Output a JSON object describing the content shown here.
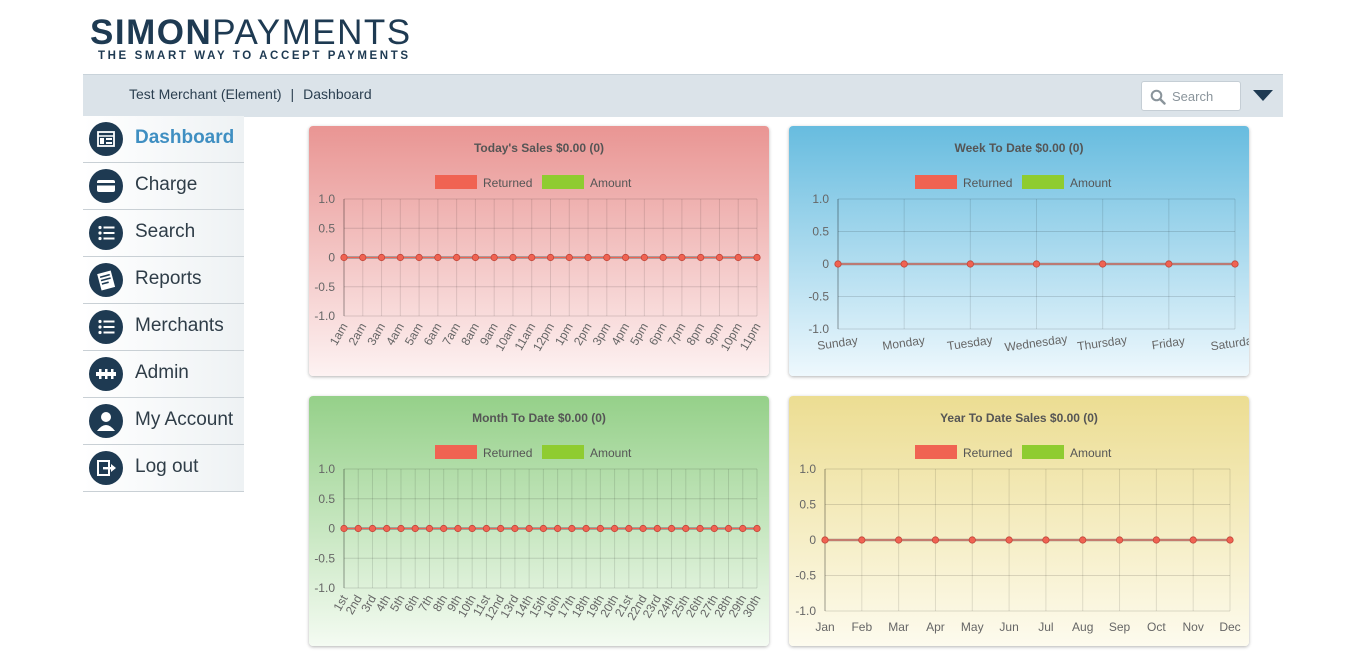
{
  "logo": {
    "bold": "SIMON",
    "light": "PAYMENTS",
    "tagline": "THE SMART WAY TO ACCEPT PAYMENTS"
  },
  "breadcrumb": {
    "merchant": "Test Merchant (Element)",
    "separator": "|",
    "page": "Dashboard"
  },
  "search": {
    "placeholder": "Search",
    "value": ""
  },
  "sidebar": {
    "items": [
      {
        "label": "Dashboard",
        "icon": "dashboard-icon",
        "active": true
      },
      {
        "label": "Charge",
        "icon": "credit-card-icon",
        "active": false
      },
      {
        "label": "Search",
        "icon": "list-icon",
        "active": false
      },
      {
        "label": "Reports",
        "icon": "report-icon",
        "active": false
      },
      {
        "label": "Merchants",
        "icon": "list-icon",
        "active": false
      },
      {
        "label": "Admin",
        "icon": "admin-icon",
        "active": false
      },
      {
        "label": "My Account",
        "icon": "user-icon",
        "active": false
      },
      {
        "label": "Log out",
        "icon": "logout-icon",
        "active": false
      }
    ]
  },
  "colors": {
    "brand": "#1e3a52",
    "active_link": "#3f8fc2",
    "returned": "#f06352",
    "amount": "#8fcc30",
    "topbar": "#dbe3e9"
  },
  "chart_data": [
    {
      "type": "line",
      "title": "Today's Sales $0.00 (0)",
      "legend": [
        "Returned",
        "Amount"
      ],
      "categories": [
        "1am",
        "2am",
        "3am",
        "4am",
        "5am",
        "6am",
        "7am",
        "8am",
        "9am",
        "10am",
        "11am",
        "12pm",
        "1pm",
        "2pm",
        "3pm",
        "4pm",
        "5pm",
        "6pm",
        "7pm",
        "8pm",
        "9pm",
        "10pm",
        "11pm"
      ],
      "series": [
        {
          "name": "Returned",
          "values": [
            0,
            0,
            0,
            0,
            0,
            0,
            0,
            0,
            0,
            0,
            0,
            0,
            0,
            0,
            0,
            0,
            0,
            0,
            0,
            0,
            0,
            0,
            0
          ]
        },
        {
          "name": "Amount",
          "values": [
            0,
            0,
            0,
            0,
            0,
            0,
            0,
            0,
            0,
            0,
            0,
            0,
            0,
            0,
            0,
            0,
            0,
            0,
            0,
            0,
            0,
            0,
            0
          ]
        }
      ],
      "yticks": [
        "1.0",
        "0.5",
        "0",
        "-0.5",
        "-1.0"
      ],
      "ylim": [
        -1,
        1
      ],
      "grid": true,
      "legend_position": "top",
      "label_rotation": "rotated"
    },
    {
      "type": "line",
      "title": "Week To Date $0.00 (0)",
      "legend": [
        "Returned",
        "Amount"
      ],
      "categories": [
        "Sunday",
        "Monday",
        "Tuesday",
        "Wednesday",
        "Thursday",
        "Friday",
        "Saturday"
      ],
      "series": [
        {
          "name": "Returned",
          "values": [
            0,
            0,
            0,
            0,
            0,
            0,
            0
          ]
        },
        {
          "name": "Amount",
          "values": [
            0,
            0,
            0,
            0,
            0,
            0,
            0
          ]
        }
      ],
      "yticks": [
        "1.0",
        "0.5",
        "0",
        "-0.5",
        "-1.0"
      ],
      "ylim": [
        -1,
        1
      ],
      "grid": true,
      "legend_position": "top",
      "label_rotation": "slight"
    },
    {
      "type": "line",
      "title": "Month To Date $0.00 (0)",
      "legend": [
        "Returned",
        "Amount"
      ],
      "categories": [
        "1st",
        "2nd",
        "3rd",
        "4th",
        "5th",
        "6th",
        "7th",
        "8th",
        "9th",
        "10th",
        "11st",
        "12nd",
        "13rd",
        "14th",
        "15th",
        "16th",
        "17th",
        "18th",
        "19th",
        "20th",
        "21st",
        "22nd",
        "23rd",
        "24th",
        "25th",
        "26th",
        "27th",
        "28th",
        "29th",
        "30th"
      ],
      "series": [
        {
          "name": "Returned",
          "values": [
            0,
            0,
            0,
            0,
            0,
            0,
            0,
            0,
            0,
            0,
            0,
            0,
            0,
            0,
            0,
            0,
            0,
            0,
            0,
            0,
            0,
            0,
            0,
            0,
            0,
            0,
            0,
            0,
            0,
            0
          ]
        },
        {
          "name": "Amount",
          "values": [
            0,
            0,
            0,
            0,
            0,
            0,
            0,
            0,
            0,
            0,
            0,
            0,
            0,
            0,
            0,
            0,
            0,
            0,
            0,
            0,
            0,
            0,
            0,
            0,
            0,
            0,
            0,
            0,
            0,
            0
          ]
        }
      ],
      "yticks": [
        "1.0",
        "0.5",
        "0",
        "-0.5",
        "-1.0"
      ],
      "ylim": [
        -1,
        1
      ],
      "grid": true,
      "legend_position": "top",
      "label_rotation": "rotated"
    },
    {
      "type": "line",
      "title": "Year To Date Sales $0.00 (0)",
      "legend": [
        "Returned",
        "Amount"
      ],
      "categories": [
        "Jan",
        "Feb",
        "Mar",
        "Apr",
        "May",
        "Jun",
        "Jul",
        "Aug",
        "Sep",
        "Oct",
        "Nov",
        "Dec"
      ],
      "series": [
        {
          "name": "Returned",
          "values": [
            0,
            0,
            0,
            0,
            0,
            0,
            0,
            0,
            0,
            0,
            0,
            0
          ]
        },
        {
          "name": "Amount",
          "values": [
            0,
            0,
            0,
            0,
            0,
            0,
            0,
            0,
            0,
            0,
            0,
            0
          ]
        }
      ],
      "yticks": [
        "1.0",
        "0.5",
        "0",
        "-0.5",
        "-1.0"
      ],
      "ylim": [
        -1,
        1
      ],
      "grid": true,
      "legend_position": "top",
      "label_rotation": "none"
    }
  ]
}
